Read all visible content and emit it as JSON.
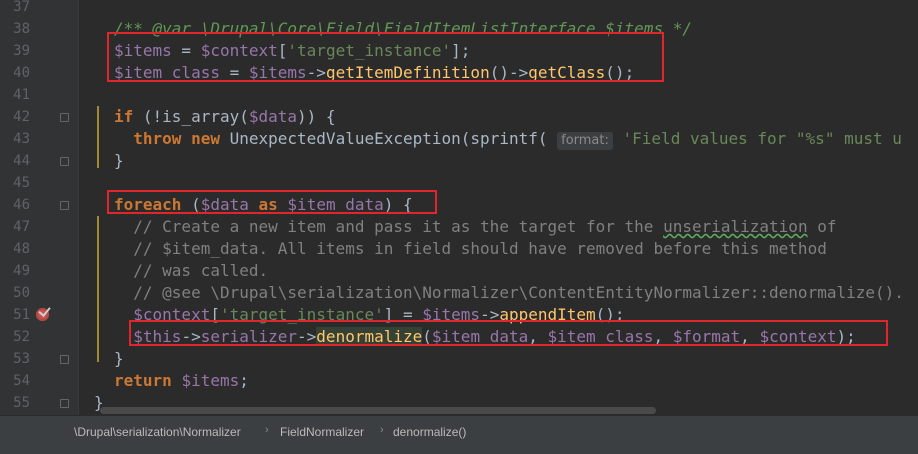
{
  "editor": {
    "lines": [
      {
        "n": "37",
        "segs": []
      },
      {
        "n": "38",
        "segs": [
          {
            "c": "cm",
            "t": "/** "
          },
          {
            "c": "cm b",
            "t": "@var"
          },
          {
            "c": "cm",
            "t": " \\Drupal\\Core\\Field\\FieldItemListInterface $items */"
          }
        ]
      },
      {
        "n": "39",
        "segs": [
          {
            "c": "var",
            "t": "$items"
          },
          {
            "c": "",
            "t": " = "
          },
          {
            "c": "var",
            "t": "$context"
          },
          {
            "c": "",
            "t": "["
          },
          {
            "c": "str",
            "t": "'target_instance'"
          },
          {
            "c": "",
            "t": "];"
          }
        ]
      },
      {
        "n": "40",
        "segs": [
          {
            "c": "var",
            "t": "$item_class"
          },
          {
            "c": "",
            "t": " = "
          },
          {
            "c": "var",
            "t": "$items"
          },
          {
            "c": "",
            "t": "->"
          },
          {
            "c": "fn",
            "t": "getItemDefinition"
          },
          {
            "c": "",
            "t": "()->"
          },
          {
            "c": "fn",
            "t": "getClass"
          },
          {
            "c": "",
            "t": "();"
          }
        ]
      },
      {
        "n": "41",
        "segs": []
      },
      {
        "n": "42",
        "segs": [
          {
            "c": "kw",
            "t": "if"
          },
          {
            "c": "",
            "t": " (!is_array("
          },
          {
            "c": "var",
            "t": "$data"
          },
          {
            "c": "",
            "t": ")) {"
          }
        ]
      },
      {
        "n": "43",
        "segs": [
          {
            "c": "",
            "t": "  "
          },
          {
            "c": "kw",
            "t": "throw new"
          },
          {
            "c": "",
            "t": " UnexpectedValueException(sprintf( "
          },
          {
            "c": "hint",
            "t": "format:"
          },
          {
            "c": "str",
            "t": " 'Field values for \"%s\" must u"
          }
        ]
      },
      {
        "n": "44",
        "segs": [
          {
            "c": "",
            "t": "}"
          }
        ]
      },
      {
        "n": "45",
        "segs": []
      },
      {
        "n": "46",
        "segs": [
          {
            "c": "kw",
            "t": "foreach"
          },
          {
            "c": "",
            "t": " ("
          },
          {
            "c": "var",
            "t": "$data"
          },
          {
            "c": "",
            "t": " "
          },
          {
            "c": "kw",
            "t": "as"
          },
          {
            "c": "",
            "t": " "
          },
          {
            "c": "var",
            "t": "$item_data"
          },
          {
            "c": "",
            "t": ") {"
          }
        ]
      },
      {
        "n": "47",
        "segs": [
          {
            "c": "lc",
            "t": "  // Create a new item and pass it as the target for the "
          },
          {
            "c": "lc squig",
            "t": "unserialization"
          },
          {
            "c": "lc",
            "t": " of"
          }
        ]
      },
      {
        "n": "48",
        "segs": [
          {
            "c": "lc",
            "t": "  // $item_data. All items in field should have removed before this method"
          }
        ]
      },
      {
        "n": "49",
        "segs": [
          {
            "c": "lc",
            "t": "  // was called."
          }
        ]
      },
      {
        "n": "50",
        "segs": [
          {
            "c": "lc",
            "t": "  // @see \\Drupal\\serialization\\Normalizer\\ContentEntityNormalizer::denormalize()."
          }
        ]
      },
      {
        "n": "51",
        "segs": [
          {
            "c": "",
            "t": "  "
          },
          {
            "c": "var",
            "t": "$context"
          },
          {
            "c": "",
            "t": "["
          },
          {
            "c": "str",
            "t": "'target_instance'"
          },
          {
            "c": "",
            "t": "] = "
          },
          {
            "c": "var",
            "t": "$items"
          },
          {
            "c": "",
            "t": "->"
          },
          {
            "c": "fn",
            "t": "appendItem"
          },
          {
            "c": "",
            "t": "();"
          }
        ]
      },
      {
        "n": "52",
        "segs": [
          {
            "c": "",
            "t": "  "
          },
          {
            "c": "var",
            "t": "$this"
          },
          {
            "c": "",
            "t": "->"
          },
          {
            "c": "var",
            "t": "serializer"
          },
          {
            "c": "",
            "t": "->"
          },
          {
            "c": "fn hl",
            "t": "denormalize"
          },
          {
            "c": "",
            "t": "("
          },
          {
            "c": "var",
            "t": "$item_data"
          },
          {
            "c": "",
            "t": ", "
          },
          {
            "c": "var",
            "t": "$item_class"
          },
          {
            "c": "",
            "t": ", "
          },
          {
            "c": "var",
            "t": "$format"
          },
          {
            "c": "",
            "t": ", "
          },
          {
            "c": "var",
            "t": "$context"
          },
          {
            "c": "",
            "t": ");"
          }
        ]
      },
      {
        "n": "53",
        "segs": [
          {
            "c": "",
            "t": "}"
          }
        ]
      },
      {
        "n": "54",
        "segs": [
          {
            "c": "kw",
            "t": "return"
          },
          {
            "c": "",
            "t": " "
          },
          {
            "c": "var",
            "t": "$items"
          },
          {
            "c": "",
            "t": ";"
          }
        ]
      },
      {
        "n": "55",
        "segs": [
          {
            "c": "",
            "t": "}"
          }
        ]
      }
    ]
  },
  "breadcrumb": {
    "items": [
      "\\Drupal\\serialization\\Normalizer",
      "FieldNormalizer",
      "denormalize()"
    ],
    "separator": "›"
  }
}
